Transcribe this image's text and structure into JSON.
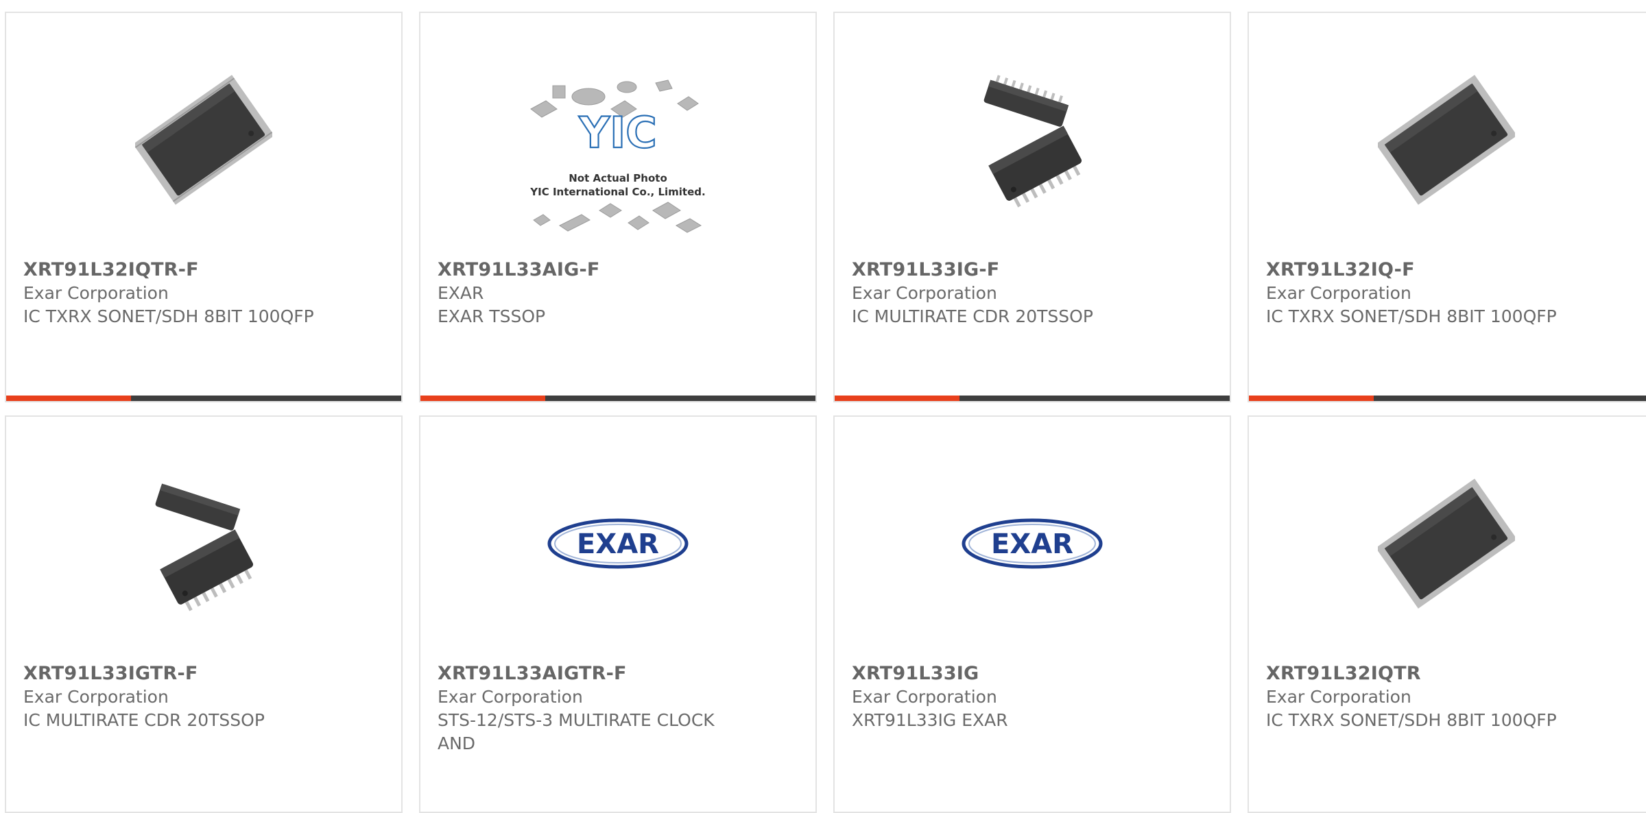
{
  "colors": {
    "accent": "#e8401c",
    "bar": "#3e3e3e",
    "border": "#e3e3e3",
    "text": "#6a6a6a",
    "exar_blue": "#1f3f8f"
  },
  "cards": [
    {
      "part": "XRT91L32IQTR-F",
      "maker": "Exar Corporation",
      "desc": "IC TXRX SONET/SDH 8BIT 100QFP",
      "image": "qfp-chip-icon"
    },
    {
      "part": "XRT91L33AIG-F",
      "maker": "EXAR",
      "desc": "EXAR TSSOP",
      "image": "yic-not-actual-photo",
      "image_caption": [
        "Not Actual Photo",
        "YIC International Co., Limited."
      ],
      "logo_text": "YIC"
    },
    {
      "part": "XRT91L33IG-F",
      "maker": "Exar Corporation",
      "desc": "IC MULTIRATE CDR 20TSSOP",
      "image": "tssop-chip-icon"
    },
    {
      "part": "XRT91L32IQ-F",
      "maker": "Exar Corporation",
      "desc": "IC TXRX SONET/SDH 8BIT 100QFP",
      "image": "qfp-chip-icon"
    },
    {
      "part": "XRT91L33IGTR-F",
      "maker": "Exar Corporation",
      "desc": "IC MULTIRATE CDR 20TSSOP",
      "image": "tssop-chip-icon"
    },
    {
      "part": "XRT91L33AIGTR-F",
      "maker": "Exar Corporation",
      "desc": "STS-12/STS-3 MULTIRATE CLOCK AND",
      "image": "exar-logo",
      "logo_text": "EXAR"
    },
    {
      "part": "XRT91L33IG",
      "maker": "Exar Corporation",
      "desc": "XRT91L33IG EXAR",
      "image": "exar-logo",
      "logo_text": "EXAR"
    },
    {
      "part": "XRT91L32IQTR",
      "maker": "Exar Corporation",
      "desc": "IC TXRX SONET/SDH 8BIT 100QFP",
      "image": "qfp-chip-icon"
    }
  ]
}
